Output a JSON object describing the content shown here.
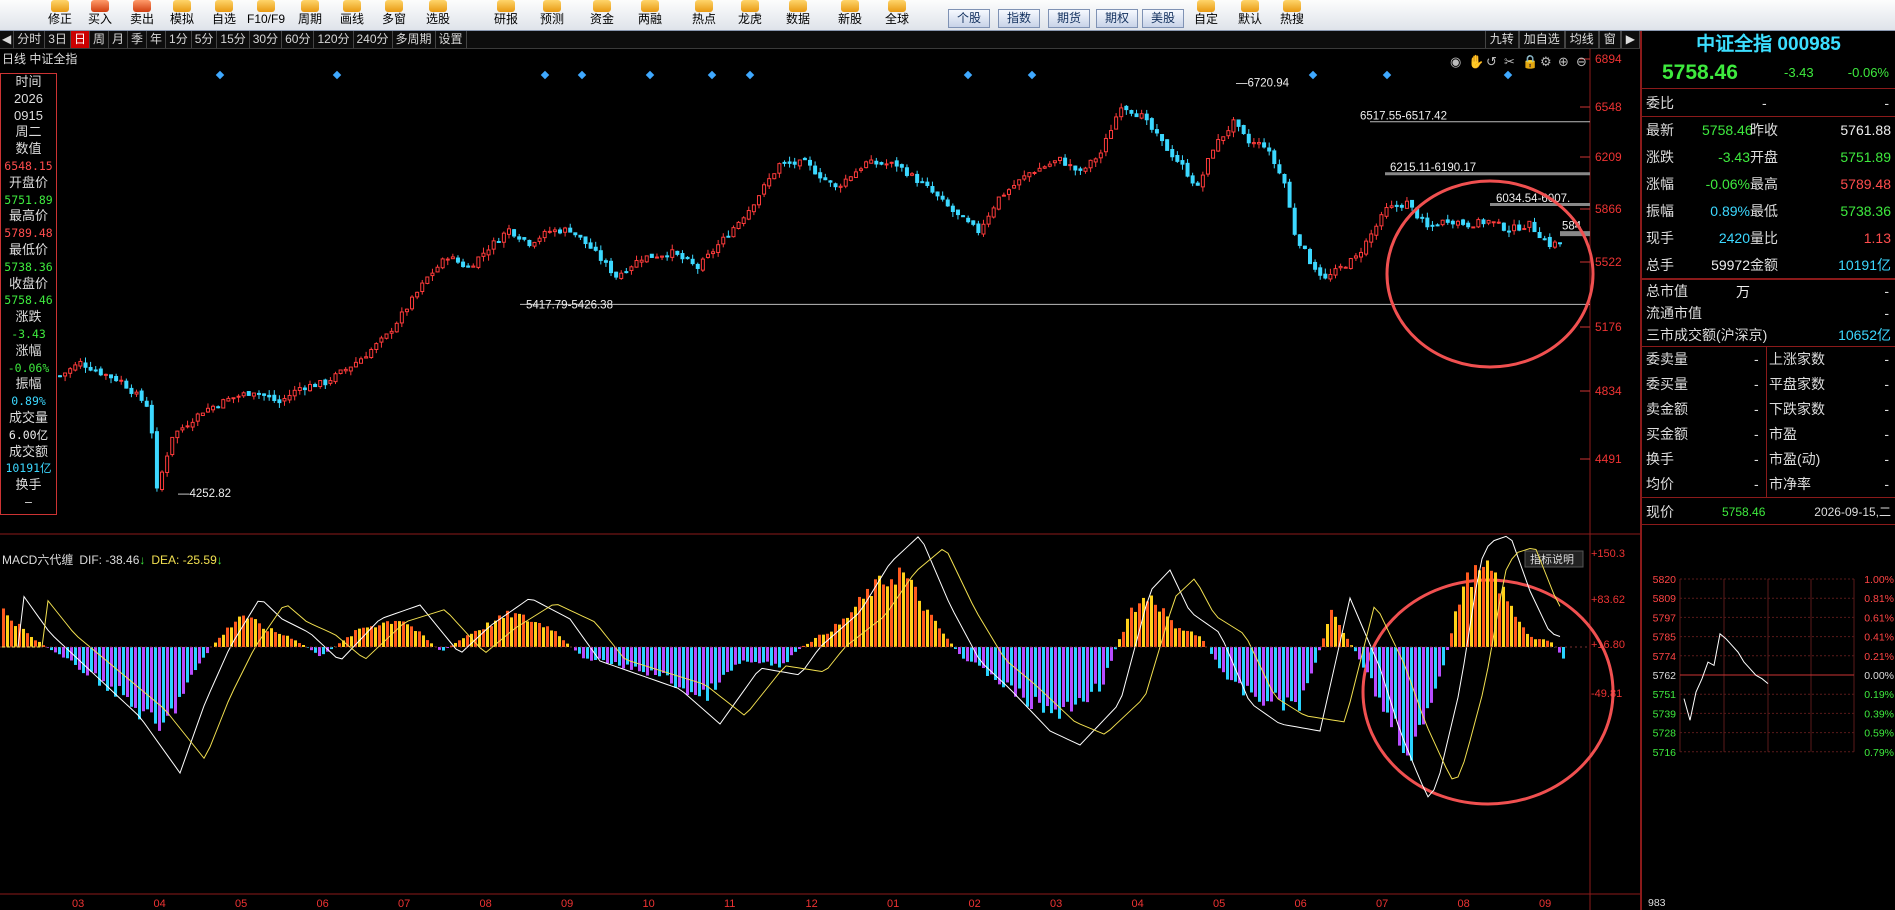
{
  "toolbar": {
    "buttons": [
      "修正",
      "买入",
      "卖出",
      "模拟",
      "自选",
      "F10/F9",
      "周期",
      "画线",
      "多窗",
      "选股"
    ],
    "nav_buttons": [
      "研报",
      "预测",
      "资金",
      "两融",
      "热点",
      "龙虎",
      "数据",
      "新股",
      "全球",
      "个股",
      "指数",
      "期货",
      "期权",
      "美股"
    ],
    "right_buttons": [
      "自定",
      "默认",
      "热搜"
    ]
  },
  "periods": [
    "分时",
    "3日",
    "日",
    "周",
    "月",
    "季",
    "年",
    "1分",
    "5分",
    "15分",
    "30分",
    "60分",
    "120分",
    "240分",
    "多周期",
    "设置"
  ],
  "periods_active": "日",
  "right_tools": [
    "九转",
    "加自选",
    "均线",
    "窗"
  ],
  "chart_label": "日线 中证全指",
  "left_info": [
    {
      "k": "时间",
      "v": ""
    },
    {
      "k": "2026",
      "v": ""
    },
    {
      "k": "0915",
      "v": ""
    },
    {
      "k": "周二",
      "v": ""
    },
    {
      "k": "数值",
      "v": "6548.15"
    },
    {
      "k": "开盘价",
      "v": "5751.89"
    },
    {
      "k": "最高价",
      "v": "5789.48"
    },
    {
      "k": "最低价",
      "v": "5738.36"
    },
    {
      "k": "收盘价",
      "v": "5758.46"
    },
    {
      "k": "涨跌",
      "v": "-3.43"
    },
    {
      "k": "涨幅",
      "v": "-0.06%"
    },
    {
      "k": "振幅",
      "v": "0.89%"
    },
    {
      "k": "成交量",
      "v": "6.00亿"
    },
    {
      "k": "成交额",
      "v": "10191亿"
    },
    {
      "k": "换手",
      "v": "—"
    }
  ],
  "axis": {
    "price_ticks": [
      "6894",
      "6548",
      "6209",
      "5866",
      "5522",
      "5176",
      "4834",
      "4491"
    ],
    "macd_ticks": [
      "+150.3",
      "+83.62",
      "+16.80",
      "-49.81"
    ],
    "months": [
      "03",
      "04",
      "05",
      "06",
      "07",
      "08",
      "09",
      "10",
      "11",
      "12",
      "01",
      "02",
      "03",
      "04",
      "05",
      "06",
      "07",
      "08",
      "09"
    ]
  },
  "annotations": {
    "high": "6720.94",
    "low": "4252.82",
    "lines": [
      "6517.55-6517.42",
      "6215.11-6190.17",
      "6034.54-6007.",
      "584",
      "5417.79-5426.38"
    ]
  },
  "macd": {
    "label": "MACD六代缠",
    "dif": "DIF: -38.46",
    "dea": "DEA: -25.59",
    "help": "指标说明"
  },
  "colors": {
    "up": "#ff3b3b",
    "down": "#3cd8ff",
    "macd_pos": "#ff5a1e",
    "macd_neg": "#29d4ff",
    "accent": "#8b1a1a"
  },
  "quote": {
    "name": "中证全指 000985",
    "price": "5758.46",
    "change": "-3.43",
    "pct": "-0.06%",
    "weibi_label": "委比",
    "weibi_v1": "-",
    "weibi_v2": "-",
    "rows": [
      [
        "最新",
        "5758.46",
        "昨收",
        "5761.88"
      ],
      [
        "涨跌",
        "-3.43",
        "开盘",
        "5751.89"
      ],
      [
        "涨幅",
        "-0.06%",
        "最高",
        "5789.48"
      ],
      [
        "振幅",
        "0.89%",
        "最低",
        "5738.36"
      ],
      [
        "现手",
        "2420",
        "量比",
        "1.13"
      ],
      [
        "总手",
        "59972万",
        "金额",
        "10191亿"
      ]
    ],
    "total_cap": "总市值",
    "circ_cap": "流通市值",
    "three_market": "三市成交额(沪深京)",
    "three_value": "10652亿",
    "stats": [
      [
        "委卖量",
        "-",
        "上涨家数",
        "-"
      ],
      [
        "委买量",
        "-",
        "平盘家数",
        "-"
      ],
      [
        "卖金额",
        "-",
        "下跌家数",
        "-"
      ],
      [
        "买金额",
        "-",
        "市盈",
        "-"
      ],
      [
        "换手",
        "-",
        "市盈(动)",
        "-"
      ],
      [
        "均价",
        "-",
        "市净率",
        "-"
      ]
    ],
    "cur_label": "现价",
    "cur_value": "5758.46",
    "cur_date": "2026-09-15,二"
  },
  "mini_chart": {
    "price_ticks": [
      "5820",
      "5809",
      "5797",
      "5785",
      "5774",
      "5762",
      "5751",
      "5739",
      "5728",
      "5716"
    ],
    "pct_ticks": [
      "1.00%",
      "0.81%",
      "0.61%",
      "0.41%",
      "0.21%",
      "0.00%",
      "0.19%",
      "0.39%",
      "0.59%",
      "0.79%"
    ],
    "vol": "983"
  }
}
